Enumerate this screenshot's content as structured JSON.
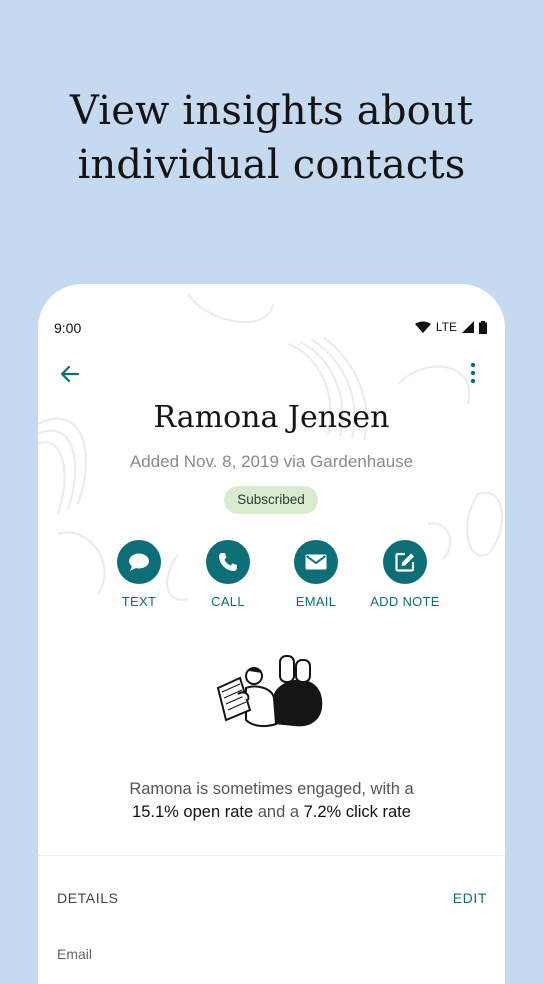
{
  "headline": {
    "line1": "View insights about",
    "line2": "individual contacts"
  },
  "status_bar": {
    "time": "9:00",
    "network": "LTE"
  },
  "contact": {
    "name": "Ramona Jensen",
    "added": "Added Nov. 8, 2019 via Gardenhause",
    "badge": "Subscribed"
  },
  "actions": [
    {
      "label": "TEXT",
      "icon": "chat-bubble-icon"
    },
    {
      "label": "CALL",
      "icon": "phone-icon"
    },
    {
      "label": "EMAIL",
      "icon": "envelope-icon"
    },
    {
      "label": "ADD NOTE",
      "icon": "note-edit-icon"
    }
  ],
  "engagement": {
    "prefix": "Ramona is sometimes engaged, with a",
    "open_rate": "15.1% open rate",
    "middle": " and a ",
    "click_rate": "7.2% click rate"
  },
  "details": {
    "heading": "DETAILS",
    "edit": "EDIT",
    "email_label": "Email"
  },
  "colors": {
    "background": "#c5daf0",
    "accent": "#0c6f78",
    "badge": "#d9ecd1"
  }
}
